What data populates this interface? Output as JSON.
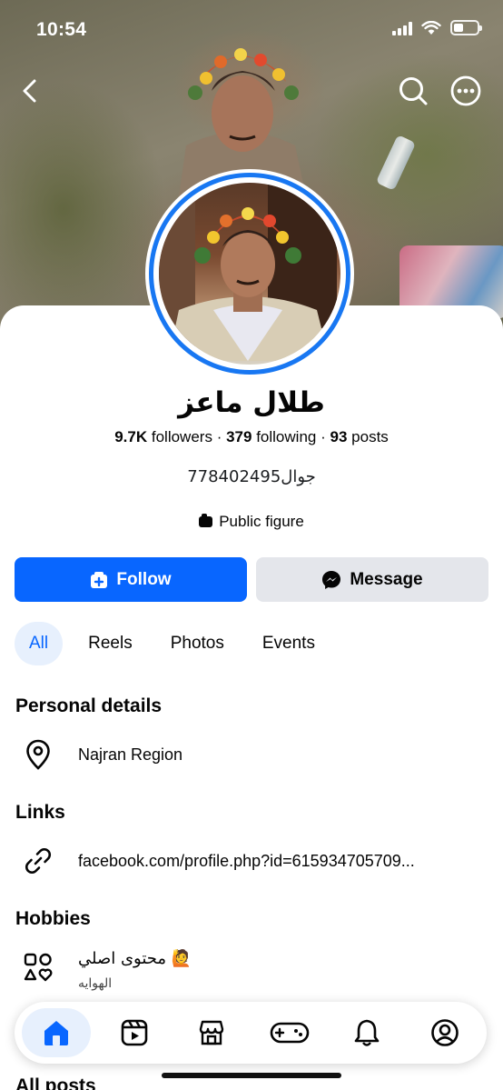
{
  "status_bar": {
    "time": "10:54"
  },
  "profile": {
    "name": "طلال ماعز",
    "followers_count": "9.7K",
    "followers_label": "followers",
    "following_count": "379",
    "following_label": "following",
    "posts_count": "93",
    "posts_label": "posts",
    "separator": "·",
    "bio": "جوال778402495",
    "category": "Public figure"
  },
  "actions": {
    "follow_label": "Follow",
    "message_label": "Message"
  },
  "tabs": [
    {
      "label": "All",
      "active": true
    },
    {
      "label": "Reels",
      "active": false
    },
    {
      "label": "Photos",
      "active": false
    },
    {
      "label": "Events",
      "active": false
    }
  ],
  "personal_details": {
    "title": "Personal details",
    "location": "Najran Region"
  },
  "links": {
    "title": "Links",
    "url": "facebook.com/profile.php?id=615934705709..."
  },
  "hobbies": {
    "title": "Hobbies",
    "item": "محتوى اصلي 🙋",
    "sub_label": "الهوايه"
  },
  "all_posts_title": "All posts",
  "colors": {
    "accent": "#0866ff",
    "ring": "#1877f2",
    "tab_active_bg": "#e7f0fd",
    "button_secondary": "#e4e6eb"
  },
  "bottom_nav": [
    {
      "icon": "home-icon",
      "active": true
    },
    {
      "icon": "reels-icon",
      "active": false
    },
    {
      "icon": "marketplace-icon",
      "active": false
    },
    {
      "icon": "gaming-icon",
      "active": false
    },
    {
      "icon": "notifications-icon",
      "active": false
    },
    {
      "icon": "profile-icon",
      "active": false
    }
  ]
}
